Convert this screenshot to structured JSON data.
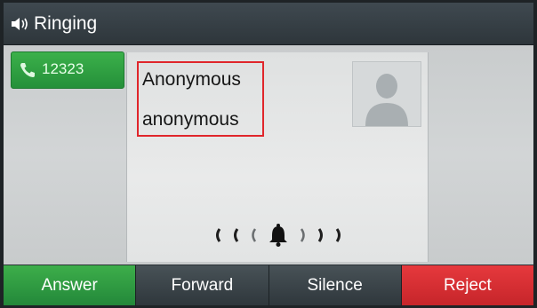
{
  "titlebar": {
    "icon": "speaker-icon",
    "title": "Ringing"
  },
  "line_key": {
    "icon": "phone-handset-icon",
    "label": "12323"
  },
  "caller": {
    "name": "Anonymous",
    "number": "anonymous",
    "highlight_color": "#e0262b"
  },
  "avatar": {
    "icon": "person-silhouette-icon"
  },
  "ring_indicator": {
    "icon": "bell-icon",
    "left_glyphs": "( ( (",
    "right_glyphs": ") ) )"
  },
  "softkeys": [
    {
      "label": "Answer",
      "color": "#2f9c40"
    },
    {
      "label": "Forward",
      "color": "#3a4348"
    },
    {
      "label": "Silence",
      "color": "#3a4348"
    },
    {
      "label": "Reject",
      "color": "#d63034"
    }
  ]
}
